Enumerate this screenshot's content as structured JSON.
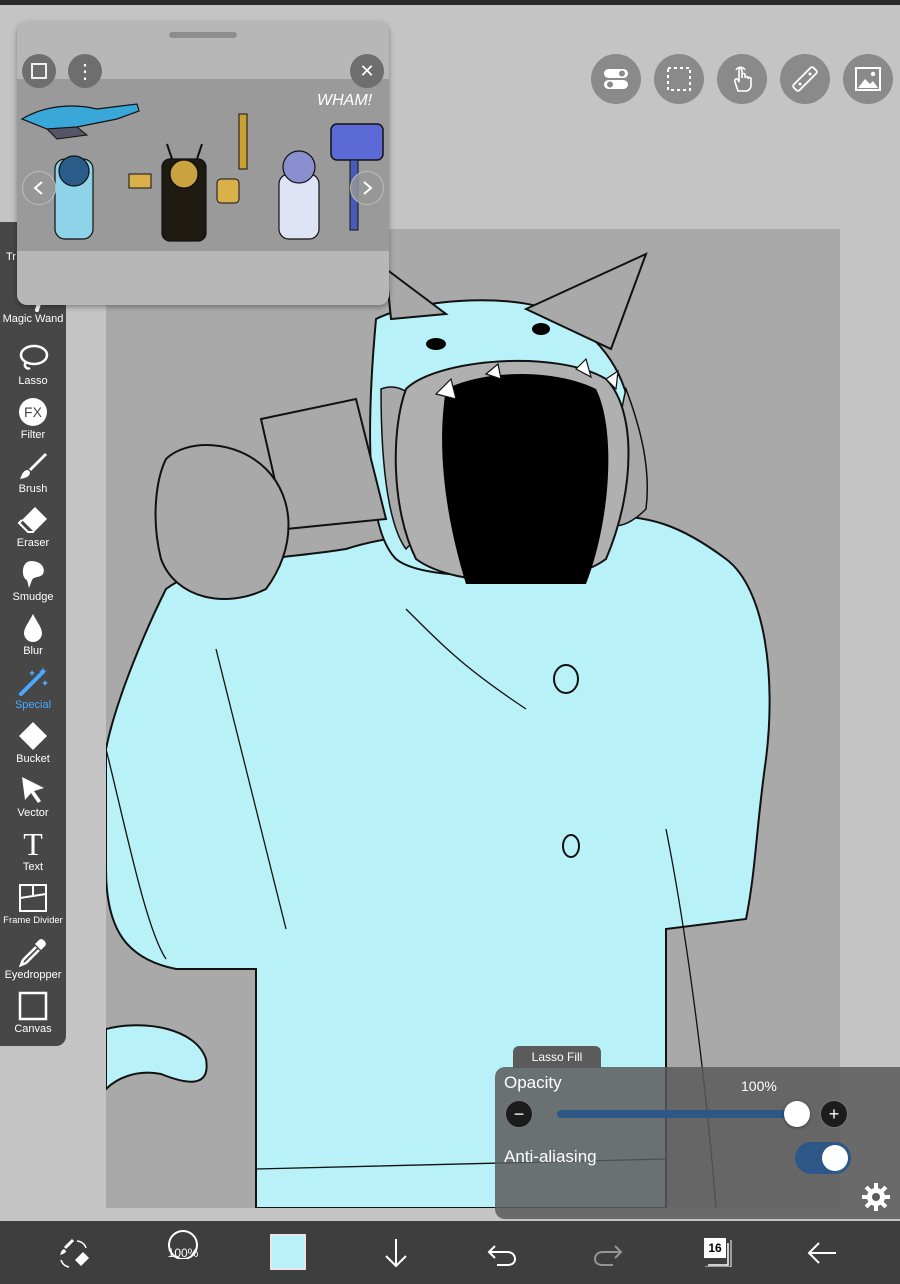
{
  "app": {
    "accent_color": "#4aa8ff",
    "fill_color": "#b8f2f8"
  },
  "tools": [
    {
      "name": "Tr",
      "icon": "transform-icon"
    },
    {
      "name": "Magic Wand",
      "icon": "magic-wand-icon"
    },
    {
      "name": "Lasso",
      "icon": "lasso-icon"
    },
    {
      "name": "Filter",
      "icon": "fx-icon",
      "glyph": "FX"
    },
    {
      "name": "Brush",
      "icon": "brush-icon"
    },
    {
      "name": "Eraser",
      "icon": "eraser-icon"
    },
    {
      "name": "Smudge",
      "icon": "smudge-icon"
    },
    {
      "name": "Blur",
      "icon": "blur-drop-icon"
    },
    {
      "name": "Special",
      "icon": "special-wand-icon",
      "active": true
    },
    {
      "name": "Bucket",
      "icon": "bucket-icon"
    },
    {
      "name": "Vector",
      "icon": "vector-arrow-icon"
    },
    {
      "name": "Text",
      "icon": "text-icon",
      "glyph": "T"
    },
    {
      "name": "Frame Divider",
      "icon": "frame-divider-icon"
    },
    {
      "name": "Eyedropper",
      "icon": "eyedropper-icon"
    },
    {
      "name": "Canvas",
      "icon": "canvas-icon"
    }
  ],
  "reference": {
    "annotation": "WHAM!",
    "prev_glyph": "<",
    "next_glyph": ">",
    "close_glyph": "✕",
    "menu_glyph": "⋮"
  },
  "lasso_fill": {
    "title": "Lasso Fill",
    "opacity_label": "Opacity",
    "opacity_value": "100%",
    "opacity": 1.0,
    "minus_glyph": "−",
    "plus_glyph": "+",
    "anti_aliasing_label": "Anti-aliasing",
    "anti_aliasing_on": true
  },
  "bottom": {
    "brush_opacity": "100%",
    "layer_count": "16"
  }
}
